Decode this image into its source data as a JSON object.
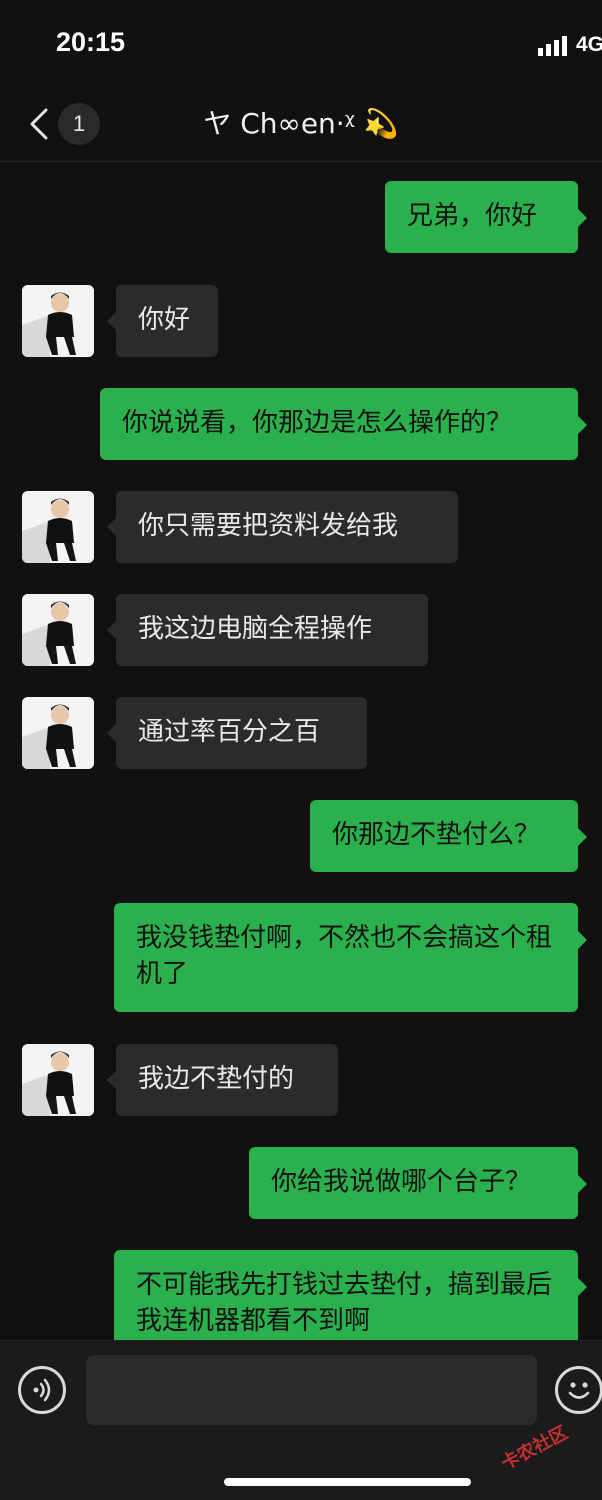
{
  "status": {
    "time": "20:15",
    "network": "4G"
  },
  "nav": {
    "badge": "1",
    "title": "ヤ Ch∞en·ᵡ 💫"
  },
  "messages": [
    {
      "from": "me",
      "text": "兄弟，你好"
    },
    {
      "from": "them",
      "text": "你好"
    },
    {
      "from": "me",
      "text": "你说说看，你那边是怎么操作的？"
    },
    {
      "from": "them",
      "text": "你只需要把资料发给我"
    },
    {
      "from": "them",
      "text": "我这边电脑全程操作"
    },
    {
      "from": "them",
      "text": "通过率百分之百"
    },
    {
      "from": "me",
      "text": "你那边不垫付么？"
    },
    {
      "from": "me",
      "text": "我没钱垫付啊，不然也不会搞这个租机了"
    },
    {
      "from": "them",
      "text": "我边不垫付的"
    },
    {
      "from": "me",
      "text": "你给我说做哪个台子？"
    },
    {
      "from": "me",
      "text": "不可能我先打钱过去垫付，搞到最后我连机器都看不到啊"
    }
  ],
  "input": {
    "placeholder": ""
  },
  "icons": {
    "back": "back-chevron-icon",
    "voice": "voice-icon",
    "emoji": "emoji-icon",
    "signal": "signal-bars-icon"
  },
  "colors": {
    "sent_bubble": "#2bb04e",
    "received_bubble": "#2b2b2b",
    "background": "#111111"
  },
  "watermark": "卡农社区"
}
